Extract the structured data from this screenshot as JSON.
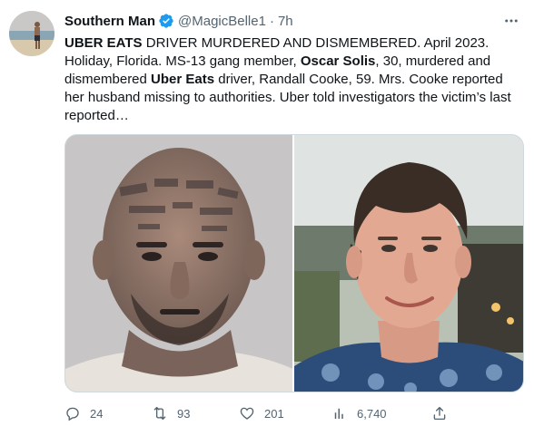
{
  "user": {
    "name": "Southern Man",
    "handle": "@MagicBelle1",
    "separator": "·",
    "time": "7h"
  },
  "tweet": {
    "p1": "UBER EATS",
    "p2": " DRIVER MURDERED AND DISMEMBERED. April 2023. Holiday, Florida. MS-13 gang member, ",
    "p3": "Oscar Solis",
    "p4": ", 30, murdered and dismembered ",
    "p5": "Uber Eats",
    "p6": " driver, Randall Cooke, 59.  Mrs. Cooke reported her husband missing to authorities. Uber told investigators the victim’s last reported…"
  },
  "actions": {
    "replies": "24",
    "retweets": "93",
    "likes": "201",
    "views": "6,740"
  },
  "colors": {
    "verified": "#1d9bf0",
    "muted": "#536471",
    "text": "#0f1419"
  },
  "icons": [
    "verified-badge-icon",
    "more-icon",
    "reply-icon",
    "retweet-icon",
    "like-icon",
    "views-icon",
    "share-icon"
  ]
}
